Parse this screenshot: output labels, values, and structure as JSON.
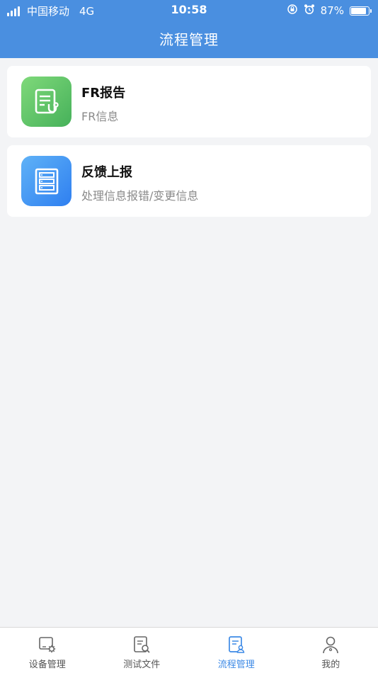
{
  "status_bar": {
    "carrier": "中国移动",
    "network": "4G",
    "time": "10:58",
    "battery_text": "87%",
    "battery_level": 0.87
  },
  "nav": {
    "title": "流程管理"
  },
  "cards": [
    {
      "title": "FR报告",
      "subtitle": "FR信息",
      "icon": "report-stethoscope-icon",
      "color": "#5cc468"
    },
    {
      "title": "反馈上报",
      "subtitle": "处理信息报错/变更信息",
      "icon": "server-rack-icon",
      "color": "#3d8ef2"
    }
  ],
  "tabs": [
    {
      "label": "设备管理",
      "icon": "device-settings-icon",
      "active": false
    },
    {
      "label": "测试文件",
      "icon": "file-search-icon",
      "active": false
    },
    {
      "label": "流程管理",
      "icon": "workflow-document-icon",
      "active": true
    },
    {
      "label": "我的",
      "icon": "user-profile-icon",
      "active": false
    }
  ],
  "colors": {
    "primary": "#4a8fe0",
    "active_tab": "#3d8ae6",
    "background": "#f3f4f6"
  }
}
